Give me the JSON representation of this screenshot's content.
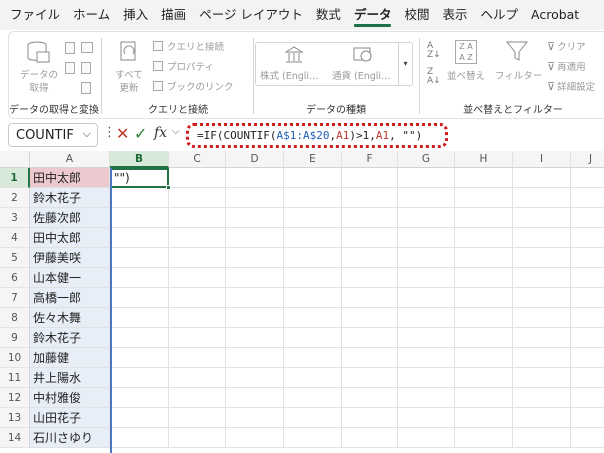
{
  "menu": {
    "items": [
      "ファイル",
      "ホーム",
      "挿入",
      "描画",
      "ページ レイアウト",
      "数式",
      "データ",
      "校閲",
      "表示",
      "ヘルプ",
      "Acrobat"
    ],
    "active": "データ"
  },
  "ribbon": {
    "get_data": {
      "label_line1": "データの",
      "label_line2": "取得",
      "group_label": "データの取得と変換"
    },
    "queries": {
      "refresh_line1": "すべて",
      "refresh_line2": "更新",
      "queries_connections": "クエリと接続",
      "properties": "プロパティ",
      "edit_links": "ブックのリンク",
      "group_label": "クエリと接続"
    },
    "data_types": {
      "stocks": "株式 (Engli…",
      "currencies": "通貨 (Engli…",
      "group_label": "データの種類"
    },
    "sort_filter": {
      "sort": "並べ替え",
      "filter": "フィルター",
      "clear": "クリア",
      "reapply": "再適用",
      "advanced": "詳細設定",
      "group_label": "並べ替えとフィルター"
    }
  },
  "formula_bar": {
    "name_box": "COUNTIF",
    "formula_prefix": "=IF(COUNTIF(",
    "formula_range": "A$1:A$20",
    "formula_sep": ", ",
    "formula_ref1": "A1",
    "formula_mid": ")>1, ",
    "formula_ref2": "A1",
    "formula_suffix": ", \"\")"
  },
  "sheet": {
    "columns": [
      "A",
      "B",
      "C",
      "D",
      "E",
      "F",
      "G",
      "H",
      "I",
      "J"
    ],
    "rows": [
      {
        "num": "1",
        "a": "田中太郎",
        "b": "\"\")"
      },
      {
        "num": "2",
        "a": "鈴木花子",
        "b": ""
      },
      {
        "num": "3",
        "a": "佐藤次郎",
        "b": ""
      },
      {
        "num": "4",
        "a": "田中太郎",
        "b": ""
      },
      {
        "num": "5",
        "a": "伊藤美咲",
        "b": ""
      },
      {
        "num": "6",
        "a": "山本健一",
        "b": ""
      },
      {
        "num": "7",
        "a": "高橋一郎",
        "b": ""
      },
      {
        "num": "8",
        "a": "佐々木舞",
        "b": ""
      },
      {
        "num": "9",
        "a": "鈴木花子",
        "b": ""
      },
      {
        "num": "10",
        "a": "加藤健",
        "b": ""
      },
      {
        "num": "11",
        "a": "井上陽水",
        "b": ""
      },
      {
        "num": "12",
        "a": "中村雅俊",
        "b": ""
      },
      {
        "num": "13",
        "a": "山田花子",
        "b": ""
      },
      {
        "num": "14",
        "a": "石川さゆり",
        "b": ""
      }
    ],
    "selected_column": "B",
    "selected_row": "1"
  },
  "colors": {
    "accent": "#217346",
    "highlight": "#d21b1b",
    "range": "#4a78c2"
  }
}
